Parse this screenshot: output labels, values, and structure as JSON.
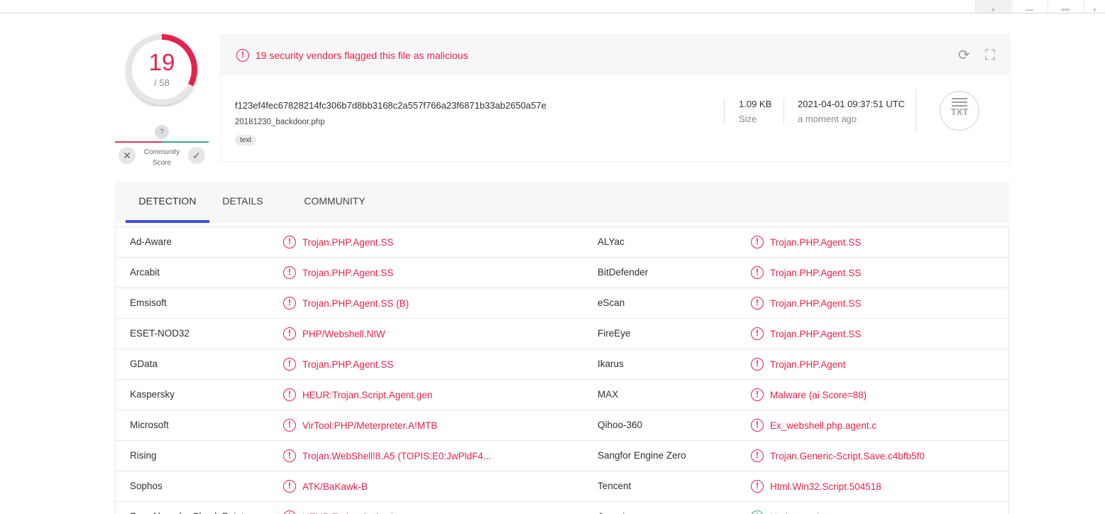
{
  "topbar": {
    "buttons": [
      "‹",
      "—",
      "▫▫▫",
      "›"
    ]
  },
  "score": {
    "positives": "19",
    "total": "/ 58",
    "fraction": 0.3276
  },
  "community": {
    "question": "?",
    "label_line1": "Community",
    "label_line2": "Score",
    "down": "✕",
    "up": "✓"
  },
  "alert": {
    "icon": "!",
    "text": "19 security vendors flagged this file as malicious",
    "reanalyze_icon": "⟳",
    "graph_icon": "⛶"
  },
  "file": {
    "hash": "f123ef4fec67828214fc306b7d8bb3168c2a557f766a23f6871b33ab2650a57e",
    "name": "20181230_backdoor.php",
    "tag": "text",
    "size": "1.09 KB",
    "size_label": "Size",
    "date": "2021-04-01 09:37:51 UTC",
    "date_label": "a moment ago",
    "type_icon_text": "TXT"
  },
  "tabs": [
    "DETECTION",
    "DETAILS",
    "COMMUNITY"
  ],
  "detections": [
    {
      "v1": "Ad-Aware",
      "r1": "Trojan.PHP.Agent.SS",
      "v2": "ALYac",
      "r2": "Trojan.PHP.Agent.SS"
    },
    {
      "v1": "Arcabit",
      "r1": "Trojan.PHP.Agent.SS",
      "v2": "BitDefender",
      "r2": "Trojan.PHP.Agent.SS"
    },
    {
      "v1": "Emsisoft",
      "r1": "Trojan.PHP.Agent.SS (B)",
      "v2": "eScan",
      "r2": "Trojan.PHP.Agent.SS"
    },
    {
      "v1": "ESET-NOD32",
      "r1": "PHP/Webshell.NIW",
      "v2": "FireEye",
      "r2": "Trojan.PHP.Agent.SS"
    },
    {
      "v1": "GData",
      "r1": "Trojan.PHP.Agent.SS",
      "v2": "Ikarus",
      "r2": "Trojan.PHP.Agent"
    },
    {
      "v1": "Kaspersky",
      "r1": "HEUR:Trojan.Script.Agent.gen",
      "v2": "MAX",
      "r2": "Malware (ai Score=88)"
    },
    {
      "v1": "Microsoft",
      "r1": "VirTool:PHP/Meterpreter.A!MTB",
      "v2": "Qihoo-360",
      "r2": "Ex_webshell.php.agent.c"
    },
    {
      "v1": "Rising",
      "r1": "Trojan.WebShell!8.A5 (TOPIS:E0:JwPldF4...",
      "v2": "Sangfor Engine Zero",
      "r2": "Trojan.Generic-Script.Save.c4bfb5f0"
    },
    {
      "v1": "Sophos",
      "r1": "ATK/BaKawk-B",
      "v2": "Tencent",
      "r2": "Html.Win32.Script.504518"
    },
    {
      "v1": "ZoneAlarm by Check Point",
      "r1": "HEUR:Trojan.Script.Agent.gen",
      "v2": "Acronis",
      "r2": "Undetected",
      "r2_clean": true
    }
  ]
}
